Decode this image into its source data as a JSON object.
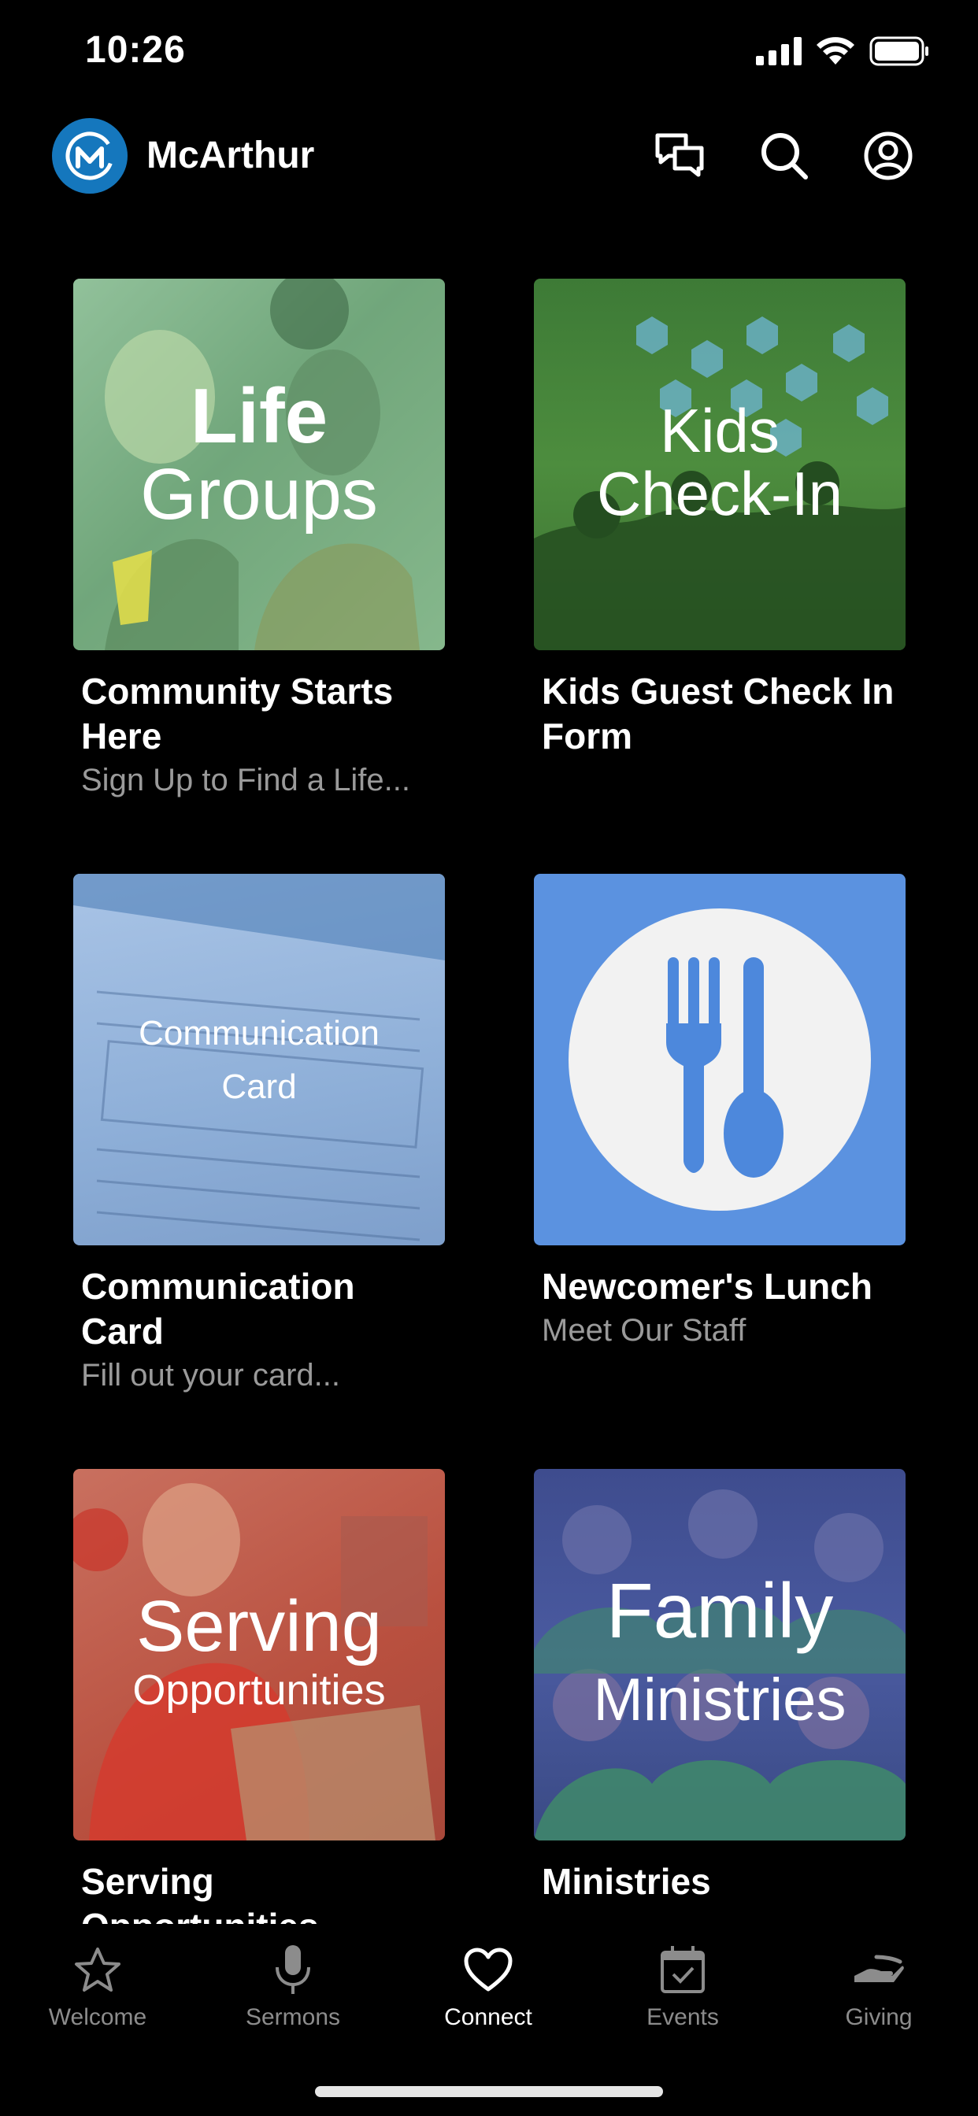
{
  "status_bar": {
    "time": "10:26"
  },
  "header": {
    "app_title": "McArthur"
  },
  "cards": [
    {
      "tile_line1": "Life",
      "tile_line2": "Groups",
      "title": "Community Starts Here",
      "subtitle": "Sign Up to Find a Life..."
    },
    {
      "tile_line1": "Kids",
      "tile_line2": "Check-In",
      "title": "Kids Guest Check In Form",
      "subtitle": ""
    },
    {
      "tile_line1": "Communication",
      "tile_line2": "Card",
      "title": "Communication Card",
      "subtitle": "Fill out your card..."
    },
    {
      "tile_line1": "",
      "tile_line2": "",
      "title": "Newcomer's Lunch",
      "subtitle": "Meet Our Staff"
    },
    {
      "tile_line1": "Serving",
      "tile_line2": "Opportunities",
      "title": "Serving Opportunities",
      "subtitle": ""
    },
    {
      "tile_line1": "Family",
      "tile_line2": "Ministries",
      "title": "Ministries",
      "subtitle": ""
    }
  ],
  "tabbar": {
    "items": [
      {
        "label": "Welcome",
        "icon": "star-icon"
      },
      {
        "label": "Sermons",
        "icon": "microphone-icon"
      },
      {
        "label": "Connect",
        "icon": "heart-icon",
        "active": true
      },
      {
        "label": "Events",
        "icon": "calendar-icon"
      },
      {
        "label": "Giving",
        "icon": "giving-hand-icon"
      }
    ]
  },
  "colors": {
    "background": "#000000",
    "logo_blue": "#1577bd",
    "life_groups_tint": "#7fb58c",
    "kids_tint": "#4a8a3c",
    "comm_card_tint": "#8fb0d8",
    "lunch_blue": "#5b92e0",
    "serving_tint": "#c45c4a",
    "family_tint": "#4f5fa6"
  }
}
